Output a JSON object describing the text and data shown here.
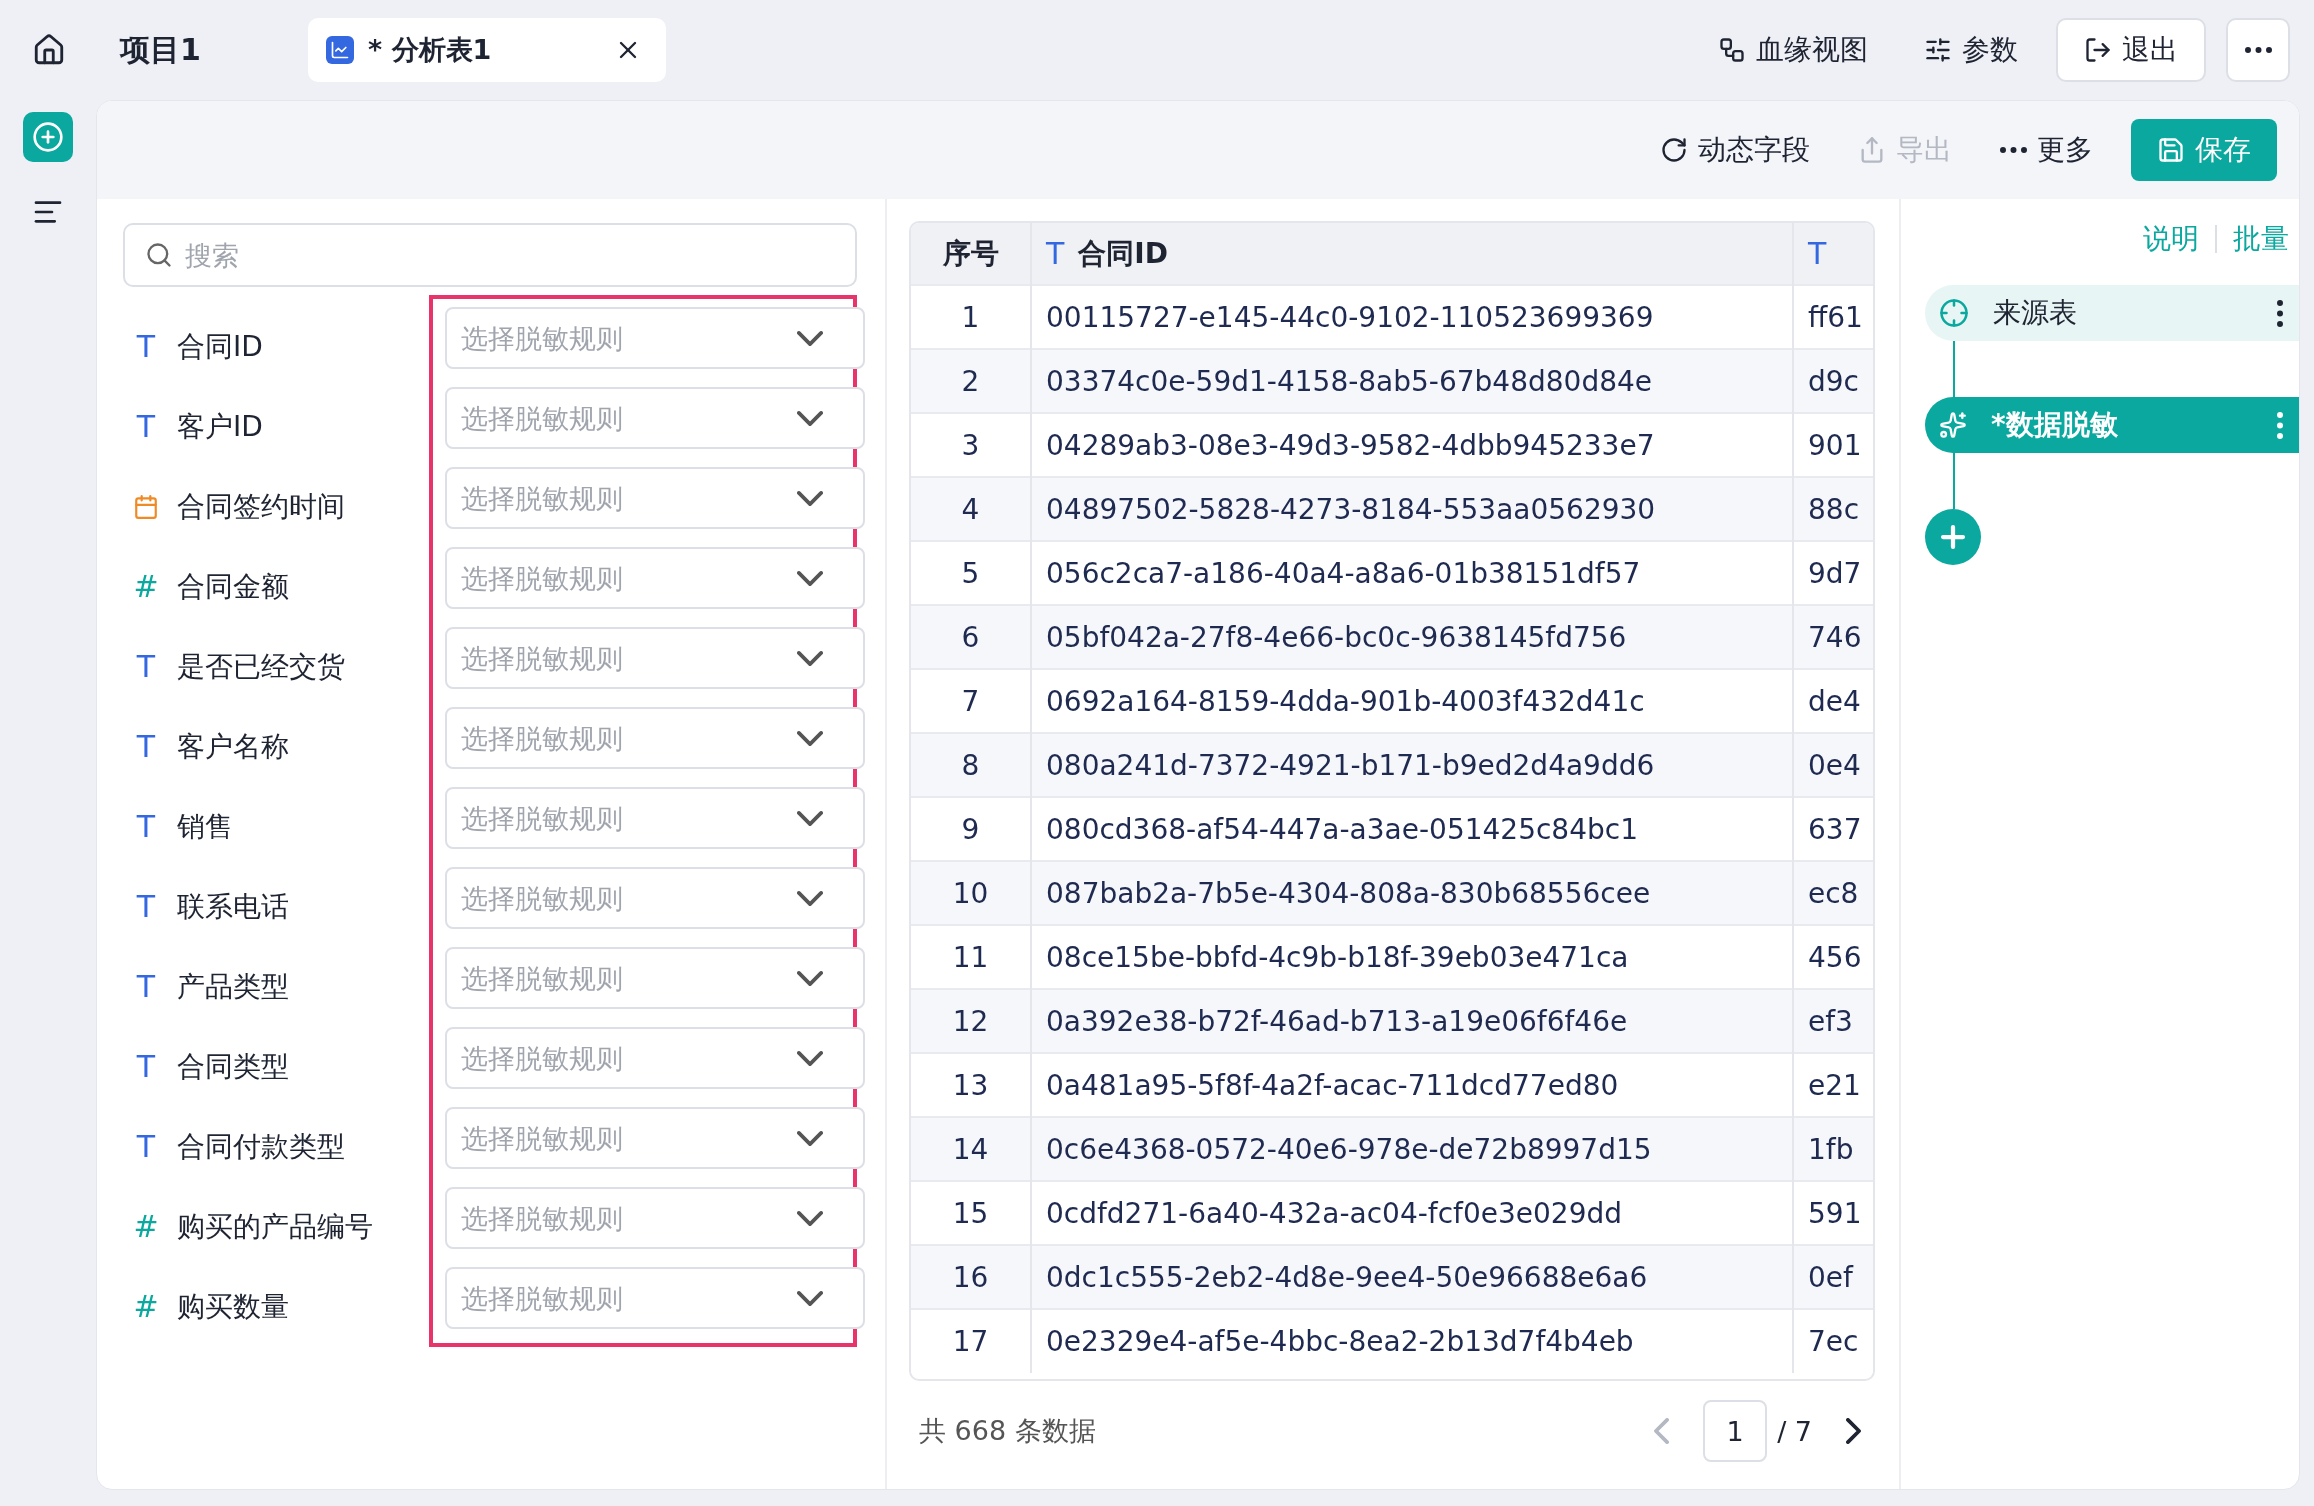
{
  "topbar": {
    "project": "项目1",
    "tab": {
      "title": "* 分析表1"
    },
    "actions": [
      {
        "kind": "plain",
        "label": "血缘视图"
      },
      {
        "kind": "plain",
        "label": "参数"
      },
      {
        "kind": "outlined",
        "label": "退出"
      }
    ]
  },
  "toolbar": [
    {
      "kind": "dynamic",
      "label": "动态字段",
      "disabled": false
    },
    {
      "kind": "export",
      "label": "导出",
      "disabled": true
    },
    {
      "kind": "more",
      "label": "更多",
      "disabled": false
    },
    {
      "kind": "save",
      "label": "保存",
      "disabled": false
    }
  ],
  "search": {
    "placeholder": "搜索"
  },
  "fields": [
    {
      "kind": "text",
      "glyph": "T",
      "name": "合同ID",
      "placeholder": "选择脱敏规则"
    },
    {
      "kind": "text",
      "glyph": "T",
      "name": "客户ID",
      "placeholder": "选择脱敏规则"
    },
    {
      "kind": "date",
      "name": "合同签约时间",
      "placeholder": "选择脱敏规则"
    },
    {
      "kind": "number",
      "glyph": "#",
      "name": "合同金额",
      "placeholder": "选择脱敏规则"
    },
    {
      "kind": "text",
      "glyph": "T",
      "name": "是否已经交货",
      "placeholder": "选择脱敏规则"
    },
    {
      "kind": "text",
      "glyph": "T",
      "name": "客户名称",
      "placeholder": "选择脱敏规则"
    },
    {
      "kind": "text",
      "glyph": "T",
      "name": "销售",
      "placeholder": "选择脱敏规则"
    },
    {
      "kind": "text",
      "glyph": "T",
      "name": "联系电话",
      "placeholder": "选择脱敏规则"
    },
    {
      "kind": "text",
      "glyph": "T",
      "name": "产品类型",
      "placeholder": "选择脱敏规则"
    },
    {
      "kind": "text",
      "glyph": "T",
      "name": "合同类型",
      "placeholder": "选择脱敏规则"
    },
    {
      "kind": "text",
      "glyph": "T",
      "name": "合同付款类型",
      "placeholder": "选择脱敏规则"
    },
    {
      "kind": "number",
      "glyph": "#",
      "name": "购买的产品编号",
      "placeholder": "选择脱敏规则"
    },
    {
      "kind": "number",
      "glyph": "#",
      "name": "购买数量",
      "placeholder": "选择脱敏规则"
    }
  ],
  "table": {
    "columns": [
      {
        "kind": "index",
        "label": "序号"
      },
      {
        "kind": "text",
        "glyph": "T",
        "label": "合同ID"
      },
      {
        "kind": "text",
        "glyph": "T"
      }
    ],
    "rows": [
      [
        "1",
        "00115727-e145-44c0-9102-110523699369",
        "ff61"
      ],
      [
        "2",
        "03374c0e-59d1-4158-8ab5-67b48d80d84e",
        "d9c"
      ],
      [
        "3",
        "04289ab3-08e3-49d3-9582-4dbb945233e7",
        "901"
      ],
      [
        "4",
        "04897502-5828-4273-8184-553aa0562930",
        "88c"
      ],
      [
        "5",
        "056c2ca7-a186-40a4-a8a6-01b38151df57",
        "9d7"
      ],
      [
        "6",
        "05bf042a-27f8-4e66-bc0c-9638145fd756",
        "746"
      ],
      [
        "7",
        "0692a164-8159-4dda-901b-4003f432d41c",
        "de4"
      ],
      [
        "8",
        "080a241d-7372-4921-b171-b9ed2d4a9dd6",
        "0e4"
      ],
      [
        "9",
        "080cd368-af54-447a-a3ae-051425c84bc1",
        "637"
      ],
      [
        "10",
        "087bab2a-7b5e-4304-808a-830b68556cee",
        "ec8"
      ],
      [
        "11",
        "08ce15be-bbfd-4c9b-b18f-39eb03e471ca",
        "456"
      ],
      [
        "12",
        "0a392e38-b72f-46ad-b713-a19e06f6f46e",
        "ef3"
      ],
      [
        "13",
        "0a481a95-5f8f-4a2f-acac-711dcd77ed80",
        "e21"
      ],
      [
        "14",
        "0c6e4368-0572-40e6-978e-de72b8997d15",
        "1fb"
      ],
      [
        "15",
        "0cdfd271-6a40-432a-ac04-fcf0e3e029dd",
        "591"
      ],
      [
        "16",
        "0dc1c555-2eb2-4d8e-9ee4-50e96688e6a6",
        "0ef"
      ],
      [
        "17",
        "0e2329e4-af5e-4bbc-8ea2-2b13d7f4b4eb",
        "7ec"
      ]
    ]
  },
  "footer": {
    "total": "共 668 条数据",
    "page": "1",
    "pages": "/ 7",
    "prev_disabled": true
  },
  "right_panel": {
    "links": [
      "说明",
      "批量"
    ],
    "nodes": [
      {
        "kind": "source",
        "label": "来源表",
        "selected": false
      },
      {
        "kind": "mask",
        "label": "*数据脱敏",
        "selected": true
      }
    ]
  }
}
